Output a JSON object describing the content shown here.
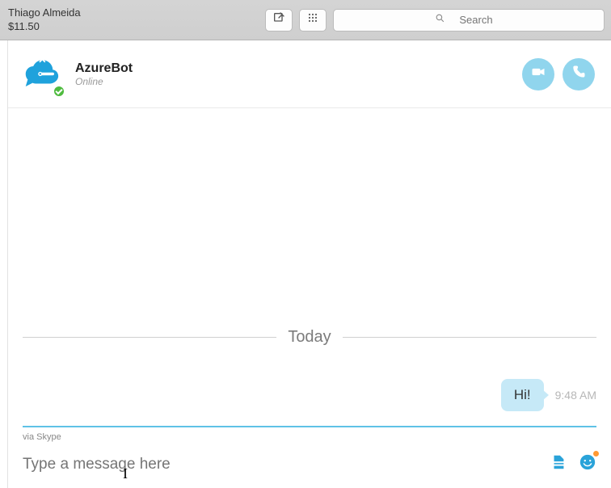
{
  "header": {
    "user_name": "Thiago Almeida",
    "credit": "$11.50",
    "search_placeholder": "Search"
  },
  "contact": {
    "name": "AzureBot",
    "status": "Online"
  },
  "chat": {
    "date_label": "Today",
    "messages": [
      {
        "text": "Hi!",
        "time": "9:48 AM"
      }
    ]
  },
  "composer": {
    "via_text": "via Skype",
    "placeholder": "Type a message here"
  },
  "colors": {
    "accent": "#1fa2dc",
    "bubble": "#c6e9f7"
  }
}
